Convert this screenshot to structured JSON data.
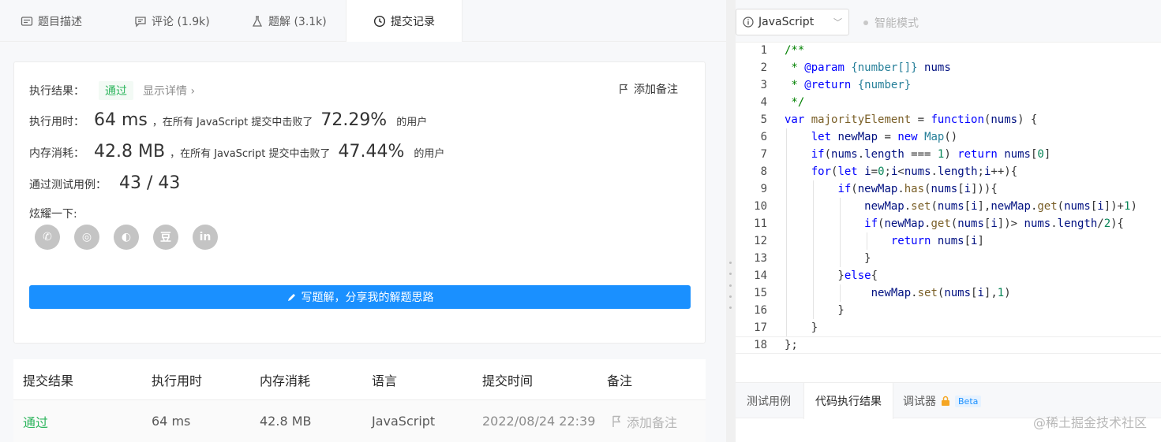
{
  "tabs": [
    {
      "label": "题目描述",
      "icon": "description-icon"
    },
    {
      "label": "评论 (1.9k)",
      "icon": "comment-icon"
    },
    {
      "label": "题解 (3.1k)",
      "icon": "flask-icon"
    },
    {
      "label": "提交记录",
      "icon": "clock-icon"
    }
  ],
  "result": {
    "status_label": "执行结果：",
    "status_value": "通过",
    "detail_link": "显示详情 ›",
    "add_note": "添加备注",
    "time_label": "执行用时：",
    "time_value": "64 ms",
    "time_text": "，在所有 JavaScript 提交中击败了",
    "time_percent": "72.29%",
    "time_suffix": "的用户",
    "mem_label": "内存消耗：",
    "mem_value": "42.8 MB",
    "mem_text": "，在所有 JavaScript 提交中击败了",
    "mem_percent": "47.44%",
    "mem_suffix": "的用户",
    "cases_label": "通过测试用例：",
    "cases_value": "43 / 43",
    "share_label": "炫耀一下:",
    "socials": [
      "wechat-icon",
      "weibo-icon",
      "qq-icon",
      "douban-icon",
      "linkedin-icon"
    ],
    "social_glyphs": [
      "✆",
      "◎",
      "◐",
      "豆",
      "in"
    ],
    "write_button": "写题解，分享我的解题思路"
  },
  "table": {
    "headers": [
      "提交结果",
      "执行用时",
      "内存消耗",
      "语言",
      "提交时间",
      "备注"
    ],
    "row": [
      "通过",
      "64 ms",
      "42.8 MB",
      "JavaScript",
      "2022/08/24 22:39",
      "添加备注"
    ]
  },
  "editor": {
    "language": "JavaScript",
    "smart_mode": "智能模式",
    "line_numbers": [
      "1",
      "2",
      "3",
      "4",
      "5",
      "6",
      "7",
      "8",
      "9",
      "10",
      "11",
      "12",
      "13",
      "14",
      "15",
      "16",
      "17",
      "18"
    ]
  },
  "bottom_tabs": [
    "测试用例",
    "代码执行结果",
    "调试器"
  ],
  "beta_label": "Beta",
  "watermark": "@稀土掘金技术社区",
  "colors": {
    "accent": "#1a90ff",
    "success": "#2db55d"
  }
}
